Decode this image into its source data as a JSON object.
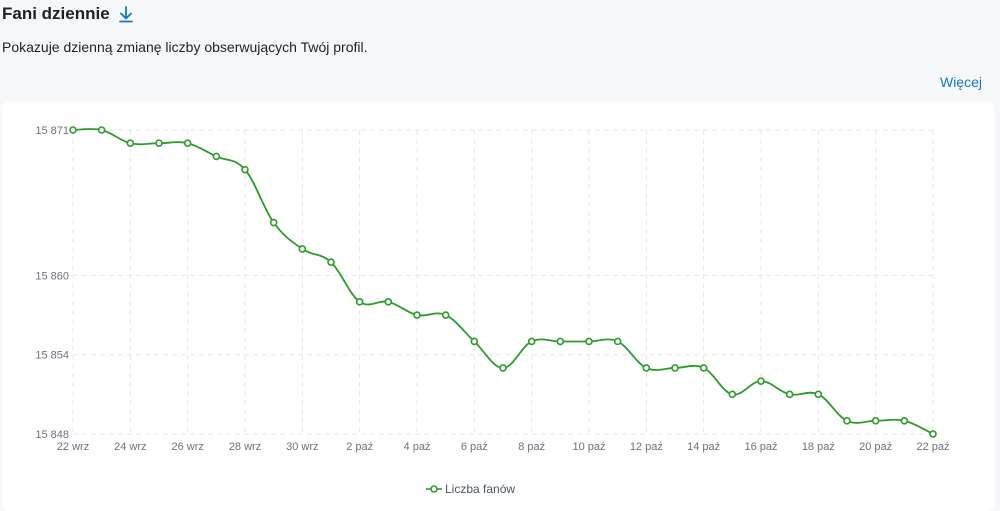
{
  "header": {
    "title": "Fani dziennie",
    "subtitle": "Pokazuje dzienną zmianę liczby obserwujących Twój profil.",
    "more_link": "Więcej",
    "download_icon": "download-icon"
  },
  "colors": {
    "series": "#2e9c2a",
    "link": "#1877c9",
    "grid": "#e5e7eb"
  },
  "chart_data": {
    "type": "line",
    "title": "",
    "xlabel": "",
    "ylabel": "",
    "x_ticks": [
      "22 wrz",
      "24 wrz",
      "26 wrz",
      "28 wrz",
      "30 wrz",
      "2 paź",
      "4 paź",
      "6 paź",
      "8 paź",
      "10 paź",
      "12 paź",
      "14 paź",
      "16 paź",
      "18 paź",
      "20 paź",
      "22 paź"
    ],
    "y_ticks": [
      "15 871",
      "15 860",
      "15 854",
      "15 848"
    ],
    "y_tick_values": [
      15871,
      15860,
      15854,
      15848
    ],
    "ylim": [
      15848,
      15871
    ],
    "grid": true,
    "legend_position": "bottom",
    "series": [
      {
        "name": "Liczba fanów",
        "x": [
          "22 wrz",
          "23 wrz",
          "24 wrz",
          "25 wrz",
          "26 wrz",
          "27 wrz",
          "28 wrz",
          "29 wrz",
          "30 wrz",
          "1 paź",
          "2 paź",
          "3 paź",
          "4 paź",
          "5 paź",
          "6 paź",
          "7 paź",
          "8 paź",
          "9 paź",
          "10 paź",
          "11 paź",
          "12 paź",
          "13 paź",
          "14 paź",
          "15 paź",
          "16 paź",
          "17 paź",
          "18 paź",
          "19 paź",
          "20 paź",
          "21 paź",
          "22 paź"
        ],
        "values": [
          15871,
          15871,
          15870,
          15870,
          15870,
          15869,
          15868,
          15864,
          15862,
          15861,
          15858,
          15858,
          15857,
          15857,
          15855,
          15853,
          15855,
          15855,
          15855,
          15855,
          15853,
          15853,
          15853,
          15851,
          15852,
          15851,
          15851,
          15849,
          15849,
          15849,
          15848
        ]
      }
    ]
  }
}
